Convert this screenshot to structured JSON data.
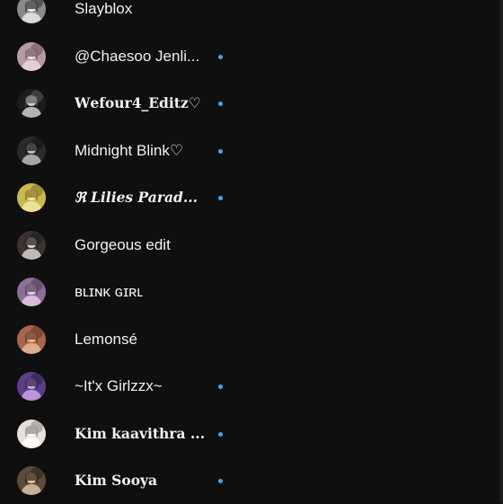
{
  "channels": [
    {
      "name": "Slayblox",
      "style": "sans",
      "new": false,
      "avatar": {
        "bg": "#8a8a8a",
        "fg": "#e8e8e8",
        "accent": "#2b2b2b",
        "icon": "avatar-light-portrait"
      }
    },
    {
      "name": "@Chaesoo Jenli...",
      "style": "sans",
      "new": true,
      "avatar": {
        "bg": "#b79aa2",
        "fg": "#e9d8dc",
        "accent": "#6e4f5a",
        "icon": "avatar-collage"
      }
    },
    {
      "name": "𝐖𝐞𝐟𝐨𝐮𝐫𝟒_𝐄𝐝𝐢𝐭𝐳♡",
      "style": "serif-bold",
      "new": true,
      "avatar": {
        "bg": "#1c1c1c",
        "fg": "#cfcfcf",
        "accent": "#5a5a5a",
        "icon": "avatar-dark-portrait"
      }
    },
    {
      "name": "Midnight Blink♡",
      "style": "sans",
      "new": true,
      "avatar": {
        "bg": "#2a2a2a",
        "fg": "#bdbdbd",
        "accent": "#111111",
        "icon": "avatar-night-portrait"
      }
    },
    {
      "name": "ℜ Lilies Parad...",
      "style": "serif-bold-italic",
      "new": true,
      "avatar": {
        "bg": "#cbb850",
        "fg": "#f4e7a0",
        "accent": "#7f6d1f",
        "icon": "avatar-yellow-flowers"
      }
    },
    {
      "name": "Gorgeous edit",
      "style": "sans",
      "new": false,
      "avatar": {
        "bg": "#3a3232",
        "fg": "#d8d0cc",
        "accent": "#1e1a1a",
        "icon": "avatar-grey-portrait"
      }
    },
    {
      "name": "ʙʟɪɴᴋ ɢɪʀʟ",
      "style": "sans",
      "new": false,
      "avatar": {
        "bg": "#8c6f98",
        "fg": "#e2cde8",
        "accent": "#4c3a56",
        "icon": "avatar-purple-portrait"
      }
    },
    {
      "name": "Lemonsé",
      "style": "sans",
      "new": false,
      "avatar": {
        "bg": "#a8654a",
        "fg": "#e8b796",
        "accent": "#5e3322",
        "icon": "avatar-warm-collage"
      }
    },
    {
      "name": "~It'x Girlzzx~",
      "style": "sans",
      "new": true,
      "avatar": {
        "bg": "#5a3f86",
        "fg": "#c9a6e8",
        "accent": "#2b1d46",
        "icon": "avatar-violet-portrait"
      }
    },
    {
      "name": "𝐊𝐢𝐦 𝐤𝐚𝐚𝐯𝐢𝐭𝐡𝐫𝐚 ...",
      "style": "serif-bold",
      "new": true,
      "avatar": {
        "bg": "#e6e1dc",
        "fg": "#ffffff",
        "accent": "#8d8580",
        "icon": "avatar-white-portrait"
      }
    },
    {
      "name": "𝐊𝐢𝐦 𝐒𝐨𝐨𝐲𝐚",
      "style": "serif-bold",
      "new": true,
      "avatar": {
        "bg": "#5d4a38",
        "fg": "#d8c2a8",
        "accent": "#2a1f16",
        "icon": "avatar-brown-portrait"
      }
    }
  ],
  "colors": {
    "background": "#0f0f0f",
    "text": "#f1f1f1",
    "new_indicator": "#3ea6ff"
  }
}
